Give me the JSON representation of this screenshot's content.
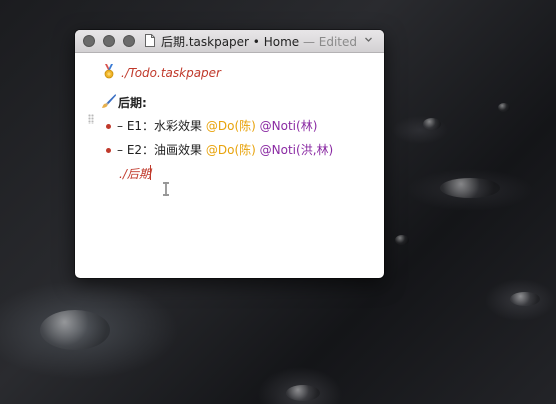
{
  "window": {
    "file_name": "后期.taskpaper",
    "separator": " • ",
    "focus": "Home",
    "status": " — Edited",
    "chevron_icon": "chevron-down-icon"
  },
  "content": {
    "link_top": "./Todo.taskpaper",
    "project": "后期:",
    "tasks": [
      {
        "dash": "–",
        "text": "E1：水彩效果",
        "tag_do": "@Do(陈)",
        "tag_noti": "@Noti(林)"
      },
      {
        "dash": "–",
        "text": "E2：油画效果",
        "tag_do": "@Do(陈)",
        "tag_noti": "@Noti(洪,林)"
      }
    ],
    "link_typing": "./后期"
  },
  "icons": {
    "medal": "medal-icon",
    "brush": "paintbrush-icon",
    "cursor": "ibeam-cursor-icon"
  },
  "colors": {
    "link": "#c0392b",
    "tag_do": "#e8a30c",
    "tag_noti": "#8a2aa3"
  }
}
